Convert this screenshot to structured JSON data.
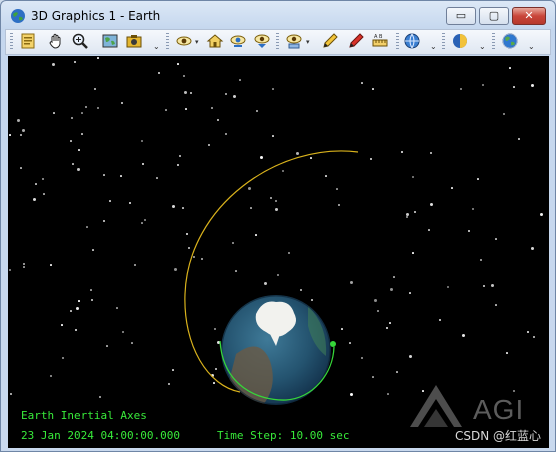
{
  "window": {
    "title": "3D Graphics 1 - Earth",
    "controls": {
      "minimize": "▭",
      "maximize": "▢",
      "close": "✕"
    }
  },
  "toolbar": {
    "groups": [
      [
        "properties-icon",
        "pan-hand-icon",
        "zoom-icon",
        "globe-map-icon",
        "snapshot-icon"
      ],
      [
        "view-from-icon",
        "home-view-icon",
        "view-to-icon",
        "view-up-icon"
      ],
      [
        "object-view-icon",
        "pencil-icon",
        "red-pencil-icon",
        "ruler-icon"
      ],
      [
        "globe-settings-icon"
      ],
      [
        "earth-lighting-icon"
      ],
      [
        "earth-globe-icon"
      ]
    ]
  },
  "viewport": {
    "hud": {
      "axes_label": "Earth Inertial Axes",
      "datetime": "23 Jan 2024 04:00:00.000",
      "timestep": "Time Step: 10.00 sec"
    },
    "logo_text": "AGI",
    "watermark": "CSDN @红蓝心"
  },
  "colors": {
    "orbit_yellow": "#d9b21c",
    "orbit_green": "#36d639",
    "hud_green": "#38ea3a",
    "space": "#000000",
    "earth_ocean": "#2a5a78"
  }
}
